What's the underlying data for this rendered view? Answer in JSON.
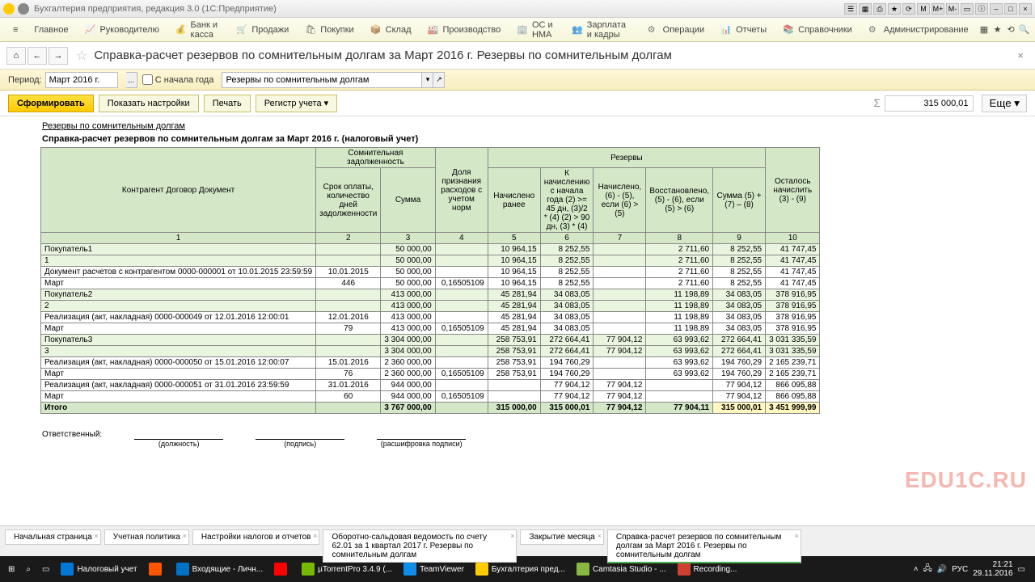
{
  "titlebar": {
    "text": "Бухгалтерия предприятия, редакция 3.0  (1С:Предприятие)"
  },
  "menu": {
    "items": [
      "Главное",
      "Руководителю",
      "Банк и касса",
      "Продажи",
      "Покупки",
      "Склад",
      "Производство",
      "ОС и НМА",
      "Зарплата и кадры",
      "Операции",
      "Отчеты",
      "Справочники",
      "Администрирование"
    ]
  },
  "nav": {
    "title": "Справка-расчет резервов по сомнительным долгам за Март 2016 г. Резервы по сомнительным долгам"
  },
  "params": {
    "period_label": "Период:",
    "period_value": "Март 2016 г.",
    "since_begin": "С начала года",
    "type_value": "Резервы по сомнительным долгам"
  },
  "actions": {
    "form": "Сформировать",
    "settings": "Показать настройки",
    "print": "Печать",
    "register": "Регистр учета ▾",
    "more": "Еще ▾",
    "total": "315 000,01"
  },
  "report": {
    "h1": "Резервы по сомнительным долгам",
    "h2": "Справка-расчет резервов по сомнительным долгам за Март 2016 г. (налоговый учет)",
    "cols": {
      "c1": "Контрагент\nДоговор\nДокумент",
      "g1": "Сомнительная задолженность",
      "c2": "Срок оплаты, количество дней задолженности",
      "c3": "Сумма",
      "c4": "Доля признания расходов с учетом норм",
      "g2": "Резервы",
      "c5": "Начислено ранее",
      "c6": "К начислению с начала года (2) >= 45 дн, (3)/2 * (4) (2) > 90 дн, (3) * (4)",
      "c7": "Начислено, (6) - (5), если (6) > (5)",
      "c8": "Восстановлено, (5) - (6), если (5) > (6)",
      "c9": "Сумма (5) + (7) – (8)",
      "c10": "Осталось начислить (3) - (9)"
    },
    "nums": [
      "1",
      "2",
      "3",
      "4",
      "5",
      "6",
      "7",
      "8",
      "9",
      "10"
    ],
    "rows": [
      {
        "cls": "grp",
        "c": [
          "Покупатель1",
          "",
          "50 000,00",
          "",
          "10 964,15",
          "8 252,55",
          "",
          "2 711,60",
          "8 252,55",
          "41 747,45"
        ]
      },
      {
        "cls": "grp",
        "c": [
          "1",
          "",
          "50 000,00",
          "",
          "10 964,15",
          "8 252,55",
          "",
          "2 711,60",
          "8 252,55",
          "41 747,45"
        ]
      },
      {
        "cls": "",
        "c": [
          "Документ расчетов с контрагентом 0000-000001 от 10.01.2015 23:59:59",
          "10.01.2015",
          "50 000,00",
          "",
          "10 964,15",
          "8 252,55",
          "",
          "2 711,60",
          "8 252,55",
          "41 747,45"
        ]
      },
      {
        "cls": "",
        "c": [
          "Март",
          "446",
          "50 000,00",
          "0,16505109",
          "10 964,15",
          "8 252,55",
          "",
          "2 711,60",
          "8 252,55",
          "41 747,45"
        ]
      },
      {
        "cls": "grp",
        "c": [
          "Покупатель2",
          "",
          "413 000,00",
          "",
          "45 281,94",
          "34 083,05",
          "",
          "11 198,89",
          "34 083,05",
          "378 916,95"
        ]
      },
      {
        "cls": "grp",
        "c": [
          "2",
          "",
          "413 000,00",
          "",
          "45 281,94",
          "34 083,05",
          "",
          "11 198,89",
          "34 083,05",
          "378 916,95"
        ]
      },
      {
        "cls": "",
        "c": [
          "Реализация (акт, накладная) 0000-000049 от 12.01.2016 12:00:01",
          "12.01.2016",
          "413 000,00",
          "",
          "45 281,94",
          "34 083,05",
          "",
          "11 198,89",
          "34 083,05",
          "378 916,95"
        ]
      },
      {
        "cls": "",
        "c": [
          "Март",
          "79",
          "413 000,00",
          "0,16505109",
          "45 281,94",
          "34 083,05",
          "",
          "11 198,89",
          "34 083,05",
          "378 916,95"
        ]
      },
      {
        "cls": "grp",
        "c": [
          "Покупатель3",
          "",
          "3 304 000,00",
          "",
          "258 753,91",
          "272 664,41",
          "77 904,12",
          "63 993,62",
          "272 664,41",
          "3 031 335,59"
        ]
      },
      {
        "cls": "grp",
        "c": [
          "3",
          "",
          "3 304 000,00",
          "",
          "258 753,91",
          "272 664,41",
          "77 904,12",
          "63 993,62",
          "272 664,41",
          "3 031 335,59"
        ]
      },
      {
        "cls": "",
        "c": [
          "Реализация (акт, накладная) 0000-000050 от 15.01.2016 12:00:07",
          "15.01.2016",
          "2 360 000,00",
          "",
          "258 753,91",
          "194 760,29",
          "",
          "63 993,62",
          "194 760,29",
          "2 165 239,71"
        ]
      },
      {
        "cls": "",
        "c": [
          "Март",
          "76",
          "2 360 000,00",
          "0,16505109",
          "258 753,91",
          "194 760,29",
          "",
          "63 993,62",
          "194 760,29",
          "2 165 239,71"
        ]
      },
      {
        "cls": "",
        "c": [
          "Реализация (акт, накладная) 0000-000051 от 31.01.2016 23:59:59",
          "31.01.2016",
          "944 000,00",
          "",
          "",
          "77 904,12",
          "77 904,12",
          "",
          "77 904,12",
          "866 095,88"
        ]
      },
      {
        "cls": "",
        "c": [
          "Март",
          "60",
          "944 000,00",
          "0,16505109",
          "",
          "77 904,12",
          "77 904,12",
          "",
          "77 904,12",
          "866 095,88"
        ]
      },
      {
        "cls": "tot hl",
        "c": [
          "Итого",
          "",
          "3 767 000,00",
          "",
          "315 000,00",
          "315 000,01",
          "77 904,12",
          "77 904,11",
          "315 000,01",
          "3 451 999,99"
        ]
      }
    ],
    "sign": {
      "head": "Ответственный:",
      "s1": "(должность)",
      "s2": "(подпись)",
      "s3": "(расшифровка подписи)"
    }
  },
  "btabs": [
    {
      "t": "Начальная страница",
      "a": false
    },
    {
      "t": "Учетная политика",
      "a": false
    },
    {
      "t": "Настройки налогов и отчетов",
      "a": false
    },
    {
      "t": "Оборотно-сальдовая ведомость по счету 62.01 за 1 квартал 2017 г. Резервы по сомнительным долгам",
      "a": false
    },
    {
      "t": "Закрытие месяца",
      "a": false
    },
    {
      "t": "Справка-расчет резервов по сомнительным долгам за Март 2016 г. Резервы по сомнительным долгам",
      "a": true
    }
  ],
  "taskbar": {
    "items": [
      {
        "t": "Налоговый учет",
        "c": "#0078d7"
      },
      {
        "t": "",
        "c": "#ff5500"
      },
      {
        "t": "Входящие - Личн...",
        "c": "#0072c6"
      },
      {
        "t": "",
        "c": "#ff0000"
      },
      {
        "t": "µTorrentPro 3.4.9 (...",
        "c": "#76b900"
      },
      {
        "t": "TeamViewer",
        "c": "#0e8ee9"
      },
      {
        "t": "Бухгалтерия пред...",
        "c": "#ffcc00"
      },
      {
        "t": "Camtasia Studio - ...",
        "c": "#88b840"
      },
      {
        "t": "Recording...",
        "c": "#d04030"
      }
    ],
    "time": "21:21",
    "date": "29.11.2016",
    "lang": "РУС"
  },
  "watermark": "EDU1C.RU"
}
